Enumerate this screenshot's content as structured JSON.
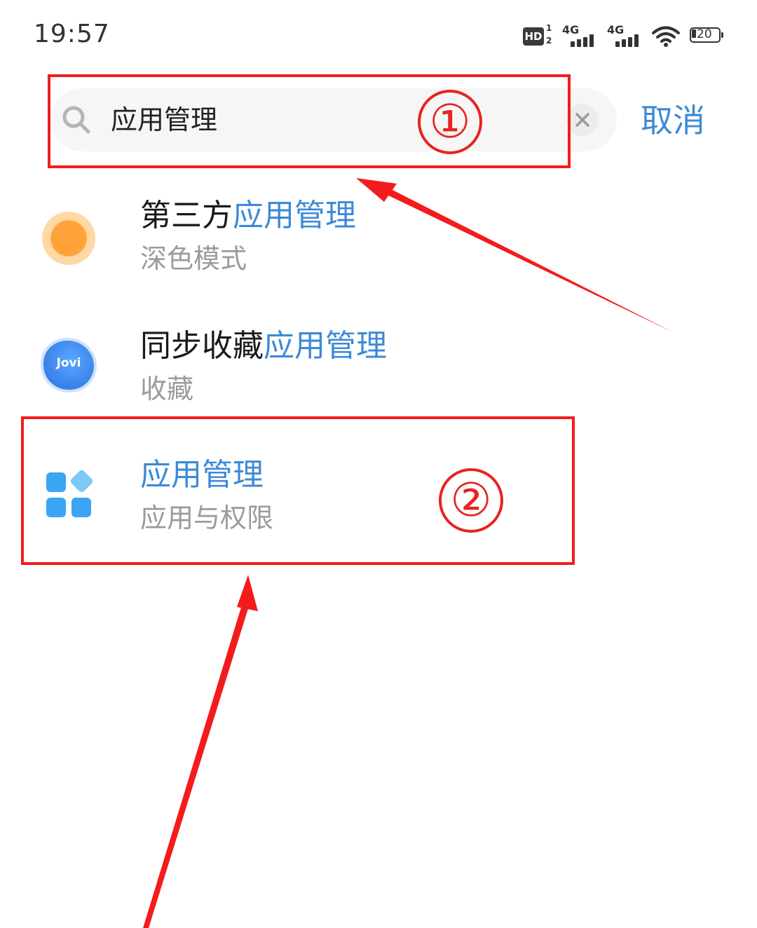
{
  "status_bar": {
    "time": "19:57",
    "hd_label": "HD",
    "hd_sup": "1",
    "hd_sub": "2",
    "signal_1_label": "4G",
    "signal_2_label": "4G",
    "battery_level": "20"
  },
  "search": {
    "query": "应用管理",
    "cancel_label": "取消",
    "icons": {
      "search": "search-icon",
      "clear": "clear-icon"
    }
  },
  "results": [
    {
      "title_prefix": "第三方",
      "title_highlight": "应用管理",
      "subtitle": "深色模式",
      "icon": "sun-icon"
    },
    {
      "title_prefix": "同步收藏",
      "title_highlight": "应用管理",
      "subtitle": "收藏",
      "icon": "jovi-icon",
      "icon_text": "Jovi"
    },
    {
      "title_prefix": "",
      "title_highlight": "应用管理",
      "subtitle": "应用与权限",
      "icon": "app-management-icon"
    }
  ],
  "annotations": {
    "step_1": "①",
    "step_2": "②",
    "color": "#f31c1c"
  },
  "colors": {
    "accent": "#3d8ad6",
    "subtitle": "#9b9b9b",
    "search_bg": "#f6f6f6"
  }
}
